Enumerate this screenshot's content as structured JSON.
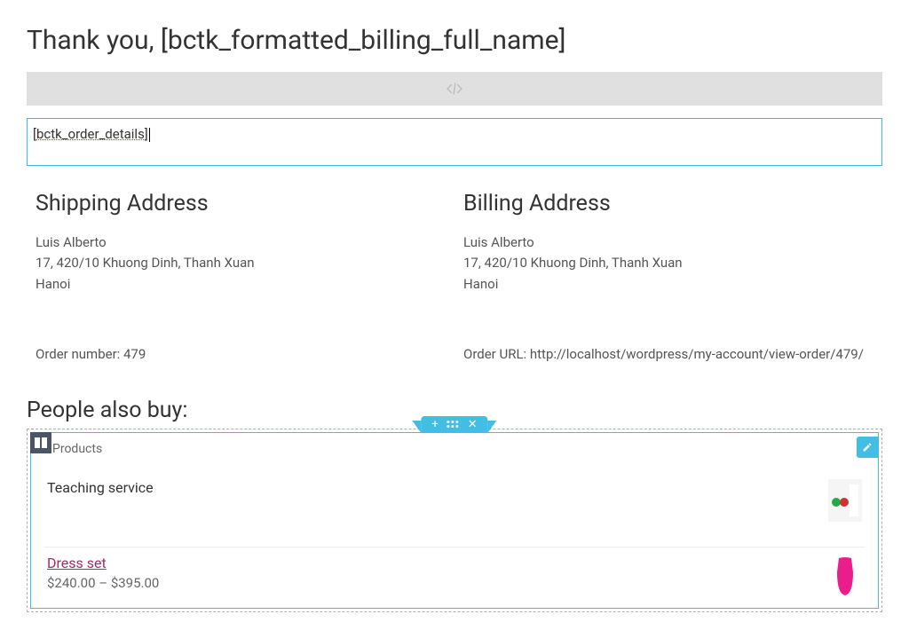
{
  "header": {
    "title": "Thank you, [bctk_formatted_billing_full_name]"
  },
  "editor": {
    "shortcode": "[bctk_order_details]"
  },
  "shipping": {
    "heading": "Shipping Address",
    "name": "Luis Alberto",
    "line1": "17, 420/10 Khuong Dinh, Thanh Xuan",
    "city": "Hanoi"
  },
  "billing": {
    "heading": "Billing Address",
    "name": "Luis Alberto",
    "line1": "17, 420/10 Khuong Dinh, Thanh Xuan",
    "city": "Hanoi"
  },
  "order": {
    "number_label": "Order number: 479",
    "url_label": "Order URL: http://localhost/wordpress/my-account/view-order/479/"
  },
  "related": {
    "heading": "People also buy:",
    "widget_label": "Products",
    "items": [
      {
        "title": "Teaching service",
        "price": "",
        "is_link": false,
        "thumb_color": "#e8e8e8"
      },
      {
        "title": "Dress set",
        "price": "$240.00 – $395.00",
        "is_link": true,
        "thumb_color": "#e91e8c"
      }
    ]
  }
}
